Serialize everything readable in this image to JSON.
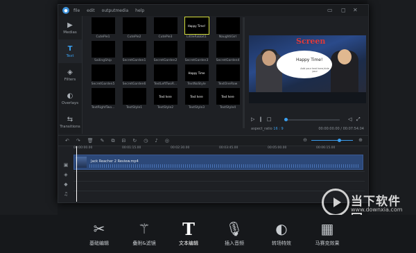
{
  "menu": {
    "file": "file",
    "edit": "edit",
    "outputmedia": "outputmedia",
    "help": "help"
  },
  "sidebar": [
    {
      "label": "Medias",
      "icon": "media-icon"
    },
    {
      "label": "Text",
      "icon": "text-icon",
      "active": true
    },
    {
      "label": "Filters",
      "icon": "filters-icon"
    },
    {
      "label": "Overlays",
      "icon": "overlays-icon"
    },
    {
      "label": "Transitions",
      "icon": "transitions-icon"
    }
  ],
  "library": [
    {
      "label": "CutePie1",
      "thumb": ""
    },
    {
      "label": "CutePie2",
      "thumb": ""
    },
    {
      "label": "CutePie3",
      "thumb": ""
    },
    {
      "label": "LittleRabbit1",
      "thumb": "Happy Time!"
    },
    {
      "label": "NaughtiGirl",
      "thumb": ""
    },
    {
      "label": "SailingShip",
      "thumb": ""
    },
    {
      "label": "SecretGarden1",
      "thumb": ""
    },
    {
      "label": "SecretGarden2",
      "thumb": ""
    },
    {
      "label": "SecretGarden3",
      "thumb": ""
    },
    {
      "label": "SecretGarden4",
      "thumb": ""
    },
    {
      "label": "SecretGarden5",
      "thumb": ""
    },
    {
      "label": "SecretGarden6",
      "thumb": ""
    },
    {
      "label": "TextLeftTwoR...",
      "thumb": ""
    },
    {
      "label": "TextNoStyle",
      "thumb": "Happy Time"
    },
    {
      "label": "TextOneRow",
      "thumb": ""
    },
    {
      "label": "TextRightTwo...",
      "thumb": ""
    },
    {
      "label": "TextStyle1",
      "thumb": ""
    },
    {
      "label": "TextStyle2",
      "thumb": "Text here"
    },
    {
      "label": "TextStyle3",
      "thumb": "Text here"
    },
    {
      "label": "TextStyle4",
      "thumb": "Text here"
    }
  ],
  "preview": {
    "screen_sign": "Screen",
    "bubble_title": "Happy Time!",
    "bubble_sub": "Add your text here,hide your",
    "ratio_label": "aspect_ratio",
    "ratio_value": "16 : 9",
    "time": "00:00:00.00 / 00:07:54.04",
    "progress_fraction": 0.0
  },
  "timeline": {
    "ruler": [
      "00:00:00.00",
      "00:01:15.00",
      "00:02:30.00",
      "00:03:45.00",
      "00:05:00.00",
      "00:06:15.00"
    ],
    "clip_name": "Jack Reacher 2 Review.mp4"
  },
  "features": [
    {
      "label": "基础编辑",
      "icon": "scissors-icon"
    },
    {
      "label": "叠附&滤镜",
      "icon": "magic-wand-icon"
    },
    {
      "label": "文本编辑",
      "icon": "text-t-icon",
      "active": true
    },
    {
      "label": "插入音频",
      "icon": "microphone-icon"
    },
    {
      "label": "转场特效",
      "icon": "transition-icon"
    },
    {
      "label": "马赛克效果",
      "icon": "mosaic-icon"
    }
  ],
  "watermark": {
    "name": "当下软件园",
    "url": "www.downxia.com"
  }
}
